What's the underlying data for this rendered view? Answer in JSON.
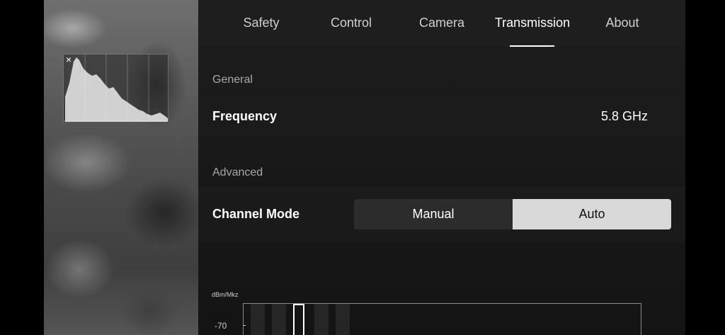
{
  "tabs": [
    {
      "label": "Safety",
      "active": false
    },
    {
      "label": "Control",
      "active": false
    },
    {
      "label": "Camera",
      "active": false
    },
    {
      "label": "Transmission",
      "active": true
    },
    {
      "label": "About",
      "active": false
    }
  ],
  "histogram": {
    "close_symbol": "×",
    "close_icon": "close-icon"
  },
  "general": {
    "section_label": "General",
    "frequency": {
      "label": "Frequency",
      "value": "5.8 GHz"
    }
  },
  "advanced": {
    "section_label": "Advanced",
    "channel_mode": {
      "label": "Channel Mode",
      "options": [
        "Manual",
        "Auto"
      ],
      "selected": "Auto"
    }
  },
  "spectrum": {
    "unit_label": "dBm/Mkz",
    "tick_label": "-70"
  },
  "colors": {
    "accent": "#ffffff",
    "selected_segment": "#d9d9d9",
    "panel_bg": "#1a1a1a"
  }
}
